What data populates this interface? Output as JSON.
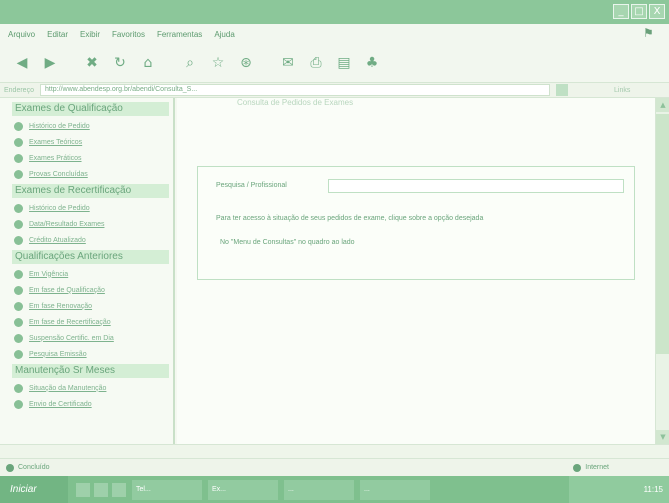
{
  "window": {
    "controls": [
      "_",
      "□",
      "X"
    ]
  },
  "menu": {
    "items": [
      "Arquivo",
      "Editar",
      "Exibir",
      "Favoritos",
      "Ferramentas",
      "Ajuda"
    ]
  },
  "address": {
    "label": "Endereço",
    "url": "http://www.abendesp.org.br/abendi/Consulta_S...",
    "links": "Links"
  },
  "sidebar": {
    "sections": [
      {
        "title": "Exames de Qualificação",
        "items": [
          "Histórico de Pedido",
          "Exames Teóricos",
          "Exames Práticos",
          "Provas Concluídas"
        ]
      },
      {
        "title": "Exames de Recertificação",
        "items": [
          "Histórico de Pedido",
          "Data/Resultado Exames",
          "Crédito Atualizado"
        ]
      },
      {
        "title": "Qualificações Anteriores",
        "items": [
          "Em Vigência",
          "Em fase de Qualificação",
          "Em fase Renovação",
          "Em fase de Recertificação",
          "Suspensão Certific. em Dia",
          "Pesquisa Emissão"
        ]
      },
      {
        "title": "Manutenção Sr Meses",
        "items": [
          "Situação da Manutenção",
          "Envio de Certificado"
        ]
      }
    ]
  },
  "content": {
    "heading": "Consulta de Pedidos de Exames",
    "form": {
      "label": "Pesquisa / Profissional",
      "input_value": "",
      "hint1": "Para ter acesso à situação de seus pedidos de exame, clique sobre a opção desejada",
      "hint2": "No \"Menu de Consultas\" no quadro ao lado"
    }
  },
  "status": {
    "left": "Concluído",
    "right": "Internet"
  },
  "taskbar": {
    "start": "Iniciar",
    "tasks": [
      "Tel...",
      "Ex...",
      "...",
      "...",
      "..."
    ],
    "clock": "11:15"
  }
}
